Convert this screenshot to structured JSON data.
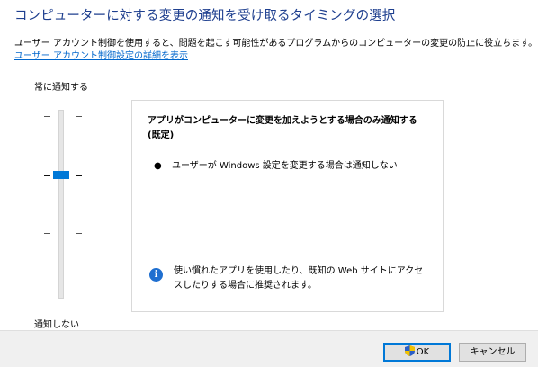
{
  "heading": "コンピューターに対する変更の通知を受け取るタイミングの選択",
  "description": "ユーザー アカウント制御を使用すると、問題を起こす可能性があるプログラムからのコンピューターの変更の防止に役立ちます。",
  "details_link": "ユーザー アカウント制御設定の詳細を表示",
  "slider": {
    "top_label": "常に通知する",
    "bottom_label": "通知しない",
    "levels": 4,
    "selected_level": 3
  },
  "panel": {
    "title": "アプリがコンピューターに変更を加えようとする場合のみ通知する (既定)",
    "bullets": [
      "ユーザーが Windows 設定を変更する場合は通知しない"
    ],
    "note": "使い慣れたアプリを使用したり、既知の Web サイトにアクセスしたりする場合に推奨されます。",
    "note_icon": "info-icon"
  },
  "buttons": {
    "ok": "OK",
    "cancel": "キャンセル"
  },
  "colors": {
    "heading": "#1e3f8f",
    "link": "#0066cc",
    "accent": "#0078d7",
    "info_icon": "#1f6fd0"
  }
}
